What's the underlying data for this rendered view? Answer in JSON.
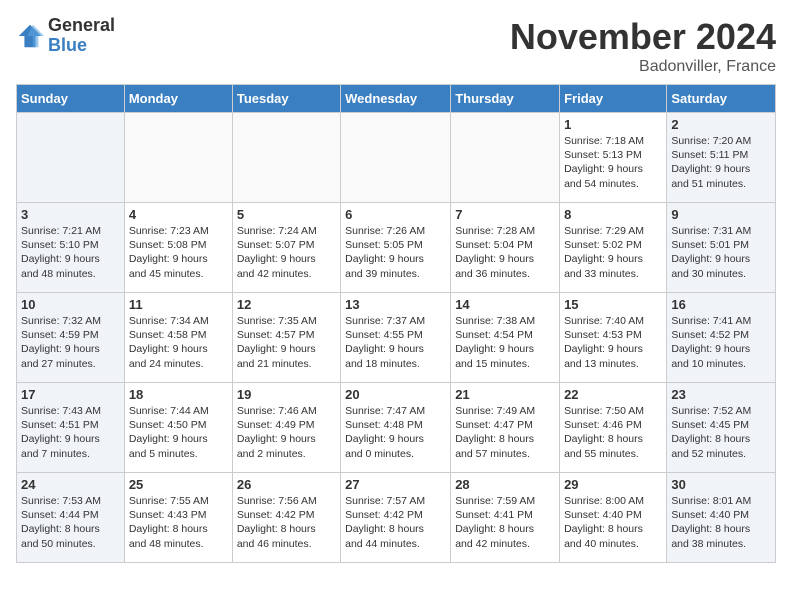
{
  "logo": {
    "general": "General",
    "blue": "Blue"
  },
  "title": "November 2024",
  "location": "Badonviller, France",
  "days_header": [
    "Sunday",
    "Monday",
    "Tuesday",
    "Wednesday",
    "Thursday",
    "Friday",
    "Saturday"
  ],
  "weeks": [
    [
      {
        "day": "",
        "info": ""
      },
      {
        "day": "",
        "info": ""
      },
      {
        "day": "",
        "info": ""
      },
      {
        "day": "",
        "info": ""
      },
      {
        "day": "",
        "info": ""
      },
      {
        "day": "1",
        "info": "Sunrise: 7:18 AM\nSunset: 5:13 PM\nDaylight: 9 hours\nand 54 minutes."
      },
      {
        "day": "2",
        "info": "Sunrise: 7:20 AM\nSunset: 5:11 PM\nDaylight: 9 hours\nand 51 minutes."
      }
    ],
    [
      {
        "day": "3",
        "info": "Sunrise: 7:21 AM\nSunset: 5:10 PM\nDaylight: 9 hours\nand 48 minutes."
      },
      {
        "day": "4",
        "info": "Sunrise: 7:23 AM\nSunset: 5:08 PM\nDaylight: 9 hours\nand 45 minutes."
      },
      {
        "day": "5",
        "info": "Sunrise: 7:24 AM\nSunset: 5:07 PM\nDaylight: 9 hours\nand 42 minutes."
      },
      {
        "day": "6",
        "info": "Sunrise: 7:26 AM\nSunset: 5:05 PM\nDaylight: 9 hours\nand 39 minutes."
      },
      {
        "day": "7",
        "info": "Sunrise: 7:28 AM\nSunset: 5:04 PM\nDaylight: 9 hours\nand 36 minutes."
      },
      {
        "day": "8",
        "info": "Sunrise: 7:29 AM\nSunset: 5:02 PM\nDaylight: 9 hours\nand 33 minutes."
      },
      {
        "day": "9",
        "info": "Sunrise: 7:31 AM\nSunset: 5:01 PM\nDaylight: 9 hours\nand 30 minutes."
      }
    ],
    [
      {
        "day": "10",
        "info": "Sunrise: 7:32 AM\nSunset: 4:59 PM\nDaylight: 9 hours\nand 27 minutes."
      },
      {
        "day": "11",
        "info": "Sunrise: 7:34 AM\nSunset: 4:58 PM\nDaylight: 9 hours\nand 24 minutes."
      },
      {
        "day": "12",
        "info": "Sunrise: 7:35 AM\nSunset: 4:57 PM\nDaylight: 9 hours\nand 21 minutes."
      },
      {
        "day": "13",
        "info": "Sunrise: 7:37 AM\nSunset: 4:55 PM\nDaylight: 9 hours\nand 18 minutes."
      },
      {
        "day": "14",
        "info": "Sunrise: 7:38 AM\nSunset: 4:54 PM\nDaylight: 9 hours\nand 15 minutes."
      },
      {
        "day": "15",
        "info": "Sunrise: 7:40 AM\nSunset: 4:53 PM\nDaylight: 9 hours\nand 13 minutes."
      },
      {
        "day": "16",
        "info": "Sunrise: 7:41 AM\nSunset: 4:52 PM\nDaylight: 9 hours\nand 10 minutes."
      }
    ],
    [
      {
        "day": "17",
        "info": "Sunrise: 7:43 AM\nSunset: 4:51 PM\nDaylight: 9 hours\nand 7 minutes."
      },
      {
        "day": "18",
        "info": "Sunrise: 7:44 AM\nSunset: 4:50 PM\nDaylight: 9 hours\nand 5 minutes."
      },
      {
        "day": "19",
        "info": "Sunrise: 7:46 AM\nSunset: 4:49 PM\nDaylight: 9 hours\nand 2 minutes."
      },
      {
        "day": "20",
        "info": "Sunrise: 7:47 AM\nSunset: 4:48 PM\nDaylight: 9 hours\nand 0 minutes."
      },
      {
        "day": "21",
        "info": "Sunrise: 7:49 AM\nSunset: 4:47 PM\nDaylight: 8 hours\nand 57 minutes."
      },
      {
        "day": "22",
        "info": "Sunrise: 7:50 AM\nSunset: 4:46 PM\nDaylight: 8 hours\nand 55 minutes."
      },
      {
        "day": "23",
        "info": "Sunrise: 7:52 AM\nSunset: 4:45 PM\nDaylight: 8 hours\nand 52 minutes."
      }
    ],
    [
      {
        "day": "24",
        "info": "Sunrise: 7:53 AM\nSunset: 4:44 PM\nDaylight: 8 hours\nand 50 minutes."
      },
      {
        "day": "25",
        "info": "Sunrise: 7:55 AM\nSunset: 4:43 PM\nDaylight: 8 hours\nand 48 minutes."
      },
      {
        "day": "26",
        "info": "Sunrise: 7:56 AM\nSunset: 4:42 PM\nDaylight: 8 hours\nand 46 minutes."
      },
      {
        "day": "27",
        "info": "Sunrise: 7:57 AM\nSunset: 4:42 PM\nDaylight: 8 hours\nand 44 minutes."
      },
      {
        "day": "28",
        "info": "Sunrise: 7:59 AM\nSunset: 4:41 PM\nDaylight: 8 hours\nand 42 minutes."
      },
      {
        "day": "29",
        "info": "Sunrise: 8:00 AM\nSunset: 4:40 PM\nDaylight: 8 hours\nand 40 minutes."
      },
      {
        "day": "30",
        "info": "Sunrise: 8:01 AM\nSunset: 4:40 PM\nDaylight: 8 hours\nand 38 minutes."
      }
    ]
  ]
}
